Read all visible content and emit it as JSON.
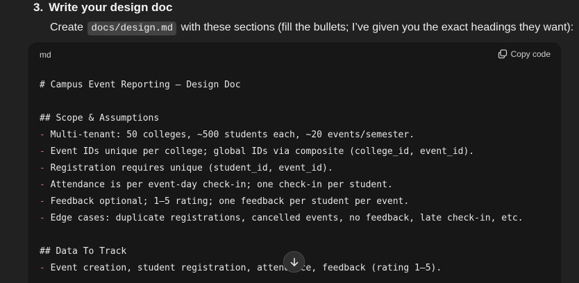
{
  "step": {
    "number": "3.",
    "title": "Write your design doc"
  },
  "intro": {
    "before": "Create",
    "code": "docs/design.md",
    "after": "with these sections (fill the bullets; I’ve given you the exact headings they want):"
  },
  "code_block": {
    "language": "md",
    "copy_label": "Copy code",
    "lines": [
      {
        "prefix": "",
        "text": "# Campus Event Reporting – Design Doc"
      },
      {
        "prefix": "",
        "text": ""
      },
      {
        "prefix": "",
        "text": "## Scope & Assumptions"
      },
      {
        "prefix": "-",
        "text": " Multi-tenant: 50 colleges, ~500 students each, ~20 events/semester."
      },
      {
        "prefix": "-",
        "text": " Event IDs unique per college; global IDs via composite (college_id, event_id)."
      },
      {
        "prefix": "-",
        "text": " Registration requires unique (student_id, event_id)."
      },
      {
        "prefix": "-",
        "text": " Attendance is per event-day check-in; one check-in per student."
      },
      {
        "prefix": "-",
        "text": " Feedback optional; 1–5 rating; one feedback per student per event."
      },
      {
        "prefix": "-",
        "text": " Edge cases: duplicate registrations, cancelled events, no feedback, late check-in, etc."
      },
      {
        "prefix": "",
        "text": ""
      },
      {
        "prefix": "",
        "text": "## Data To Track"
      },
      {
        "prefix": "-",
        "text": " Event creation, student registration, attendance, feedback (rating 1–5)."
      }
    ]
  },
  "icons": {
    "copy": "copy-icon",
    "scroll_down": "arrow-down-icon"
  },
  "colors": {
    "background": "#212121",
    "code_background": "#171717",
    "list_marker": "#e06c75"
  }
}
